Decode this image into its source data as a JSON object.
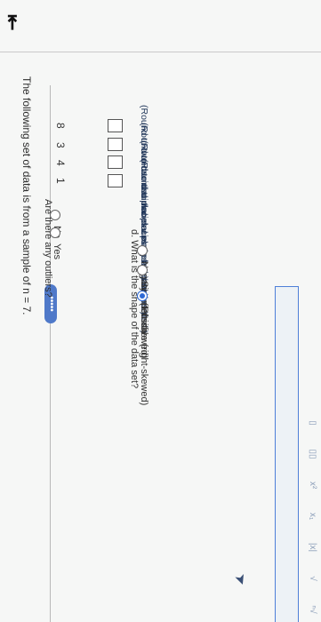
{
  "nav": {
    "back_icon": "⇤"
  },
  "question": {
    "title": "The following set of data is from a sample of n = 7.",
    "more_label": "•••••"
  },
  "data": {
    "values": [
      "8",
      "3",
      "4",
      "1"
    ],
    "notes": [
      "(Round to two decimal places as needed.)",
      "(Round to two decimal places as needed.)",
      "(Round to two decimal places as needed.)",
      "(Round to two decimal places as needed.)"
    ]
  },
  "outliers": {
    "prompt": "Are there any outliers?",
    "options": [
      "No",
      "Yes"
    ]
  },
  "shape": {
    "prompt": "d. What is the shape of the data set?",
    "options": [
      "Negative (left-skewed)",
      "Symmetrical",
      "Positive (right-skewed)"
    ],
    "selected": "Positive (right-skewed)"
  },
  "toolbar": {
    "icons": [
      "▯",
      "▯▯",
      "x²",
      "x₁",
      "|x|",
      "√",
      "ⁿ√"
    ]
  },
  "misc": {
    "cursor_icon": "➤"
  }
}
